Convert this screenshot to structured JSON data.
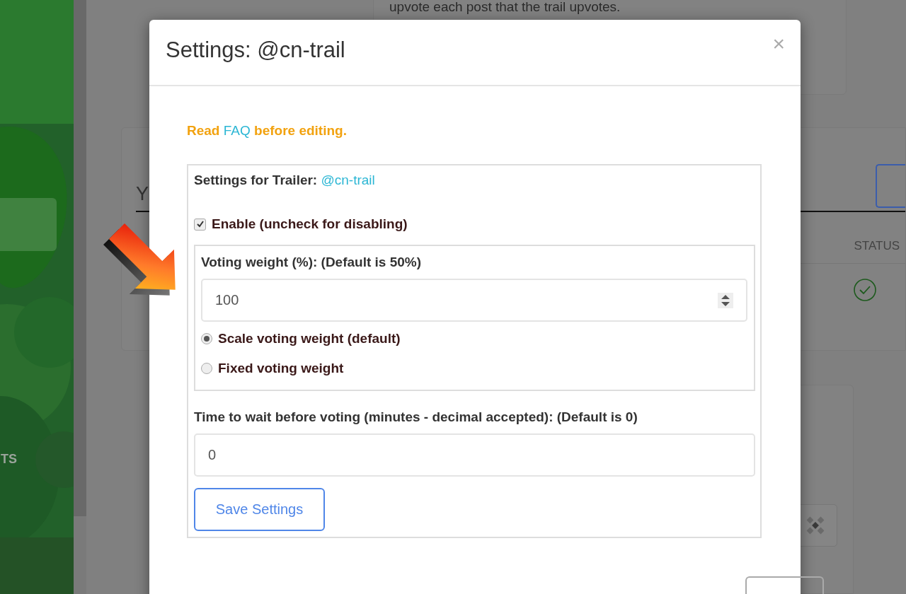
{
  "background": {
    "sidebar": {
      "items": [
        {
          "selected": true
        }
      ],
      "label": "TS"
    },
    "info_card": {
      "text": "upvote each post that the trail upvotes."
    },
    "main_card": {
      "heading": "Y",
      "table": {
        "columns": [
          "STATUS"
        ]
      }
    }
  },
  "dialog": {
    "title": "Settings: @cn-trail",
    "close": "×",
    "notice": {
      "before": "Read ",
      "link": "FAQ",
      "after": " before editing."
    },
    "trailer": {
      "label": "Settings for Trailer: ",
      "link": "@cn-trail"
    },
    "enable": {
      "label": "Enable (uncheck for disabling)",
      "checked": true
    },
    "weight": {
      "label": "Voting weight (%): (Default is 50%)",
      "value": "100",
      "options": [
        {
          "label": "Scale voting weight (default)",
          "selected": true
        },
        {
          "label": "Fixed voting weight",
          "selected": false
        }
      ]
    },
    "wait": {
      "label": "Time to wait before voting (minutes - decimal accepted): (Default is 0)",
      "value": "0"
    },
    "save_button": "Save Settings"
  }
}
